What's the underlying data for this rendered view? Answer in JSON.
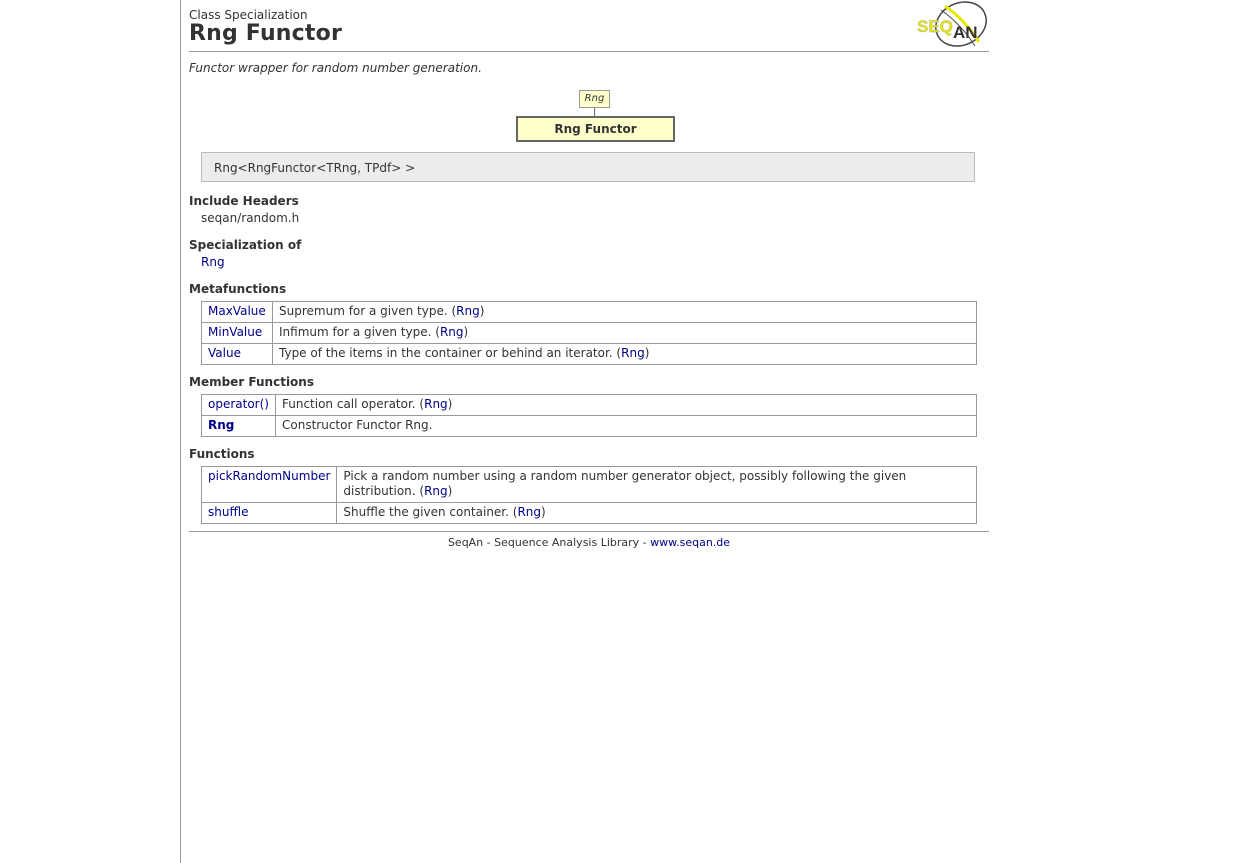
{
  "header": {
    "kind": "Class Specialization",
    "title": "Rng Functor",
    "logo_text": "SEQAN"
  },
  "summary": "Functor wrapper for random number generation.",
  "diagram": {
    "parent": "Rng",
    "self": "Rng Functor"
  },
  "signature": "Rng<RngFunctor<TRng, TPdf> >",
  "include": {
    "heading": "Include Headers",
    "value": "seqan/random.h"
  },
  "specialization_of": {
    "heading": "Specialization of",
    "value": "Rng"
  },
  "metafunctions": {
    "heading": "Metafunctions",
    "rows": [
      {
        "name": "MaxValue",
        "desc": "Supremum for a given type. (",
        "ref": "Rng",
        "close": ")"
      },
      {
        "name": "MinValue",
        "desc": "Infimum for a given type. (",
        "ref": "Rng",
        "close": ")"
      },
      {
        "name": "Value",
        "desc": "Type of the items in the container or behind an iterator. (",
        "ref": "Rng",
        "close": ")"
      }
    ]
  },
  "member_functions": {
    "heading": "Member Functions",
    "rows": [
      {
        "name": "operator()",
        "desc": "Function call operator. (",
        "ref": "Rng",
        "close": ")"
      },
      {
        "name": "Rng",
        "desc": "Constructor Functor Rng.",
        "ref": "",
        "close": ""
      }
    ]
  },
  "functions": {
    "heading": "Functions",
    "rows": [
      {
        "name": "pickRandomNumber",
        "desc": "Pick a random number using a random number generator object, possibly following the given distribution. (",
        "ref": "Rng",
        "close": ")"
      },
      {
        "name": "shuffle",
        "desc": "Shuffle the given container. (",
        "ref": "Rng",
        "close": ")"
      }
    ]
  },
  "footer": {
    "text": "SeqAn - Sequence Analysis Library - ",
    "link": "www.seqan.de"
  },
  "colors": {
    "link": "#000088",
    "box_fill": "#ffffcc",
    "logo_yellow": "#e8e800"
  }
}
